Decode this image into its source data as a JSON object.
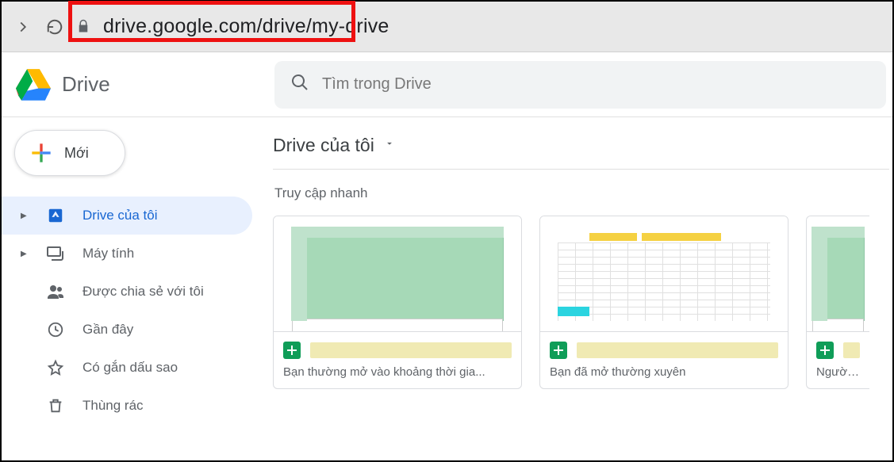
{
  "chrome": {
    "url": "drive.google.com/drive/my-drive"
  },
  "app": {
    "name": "Drive"
  },
  "search": {
    "placeholder": "Tìm trong Drive"
  },
  "sidebar": {
    "new_label": "Mới",
    "items": [
      {
        "label": "Drive của tôi",
        "icon": "my-drive-icon",
        "expandable": true,
        "active": true
      },
      {
        "label": "Máy tính",
        "icon": "computers-icon",
        "expandable": true,
        "active": false
      },
      {
        "label": "Được chia sẻ với tôi",
        "icon": "shared-icon",
        "expandable": false,
        "active": false
      },
      {
        "label": "Gần đây",
        "icon": "recent-icon",
        "expandable": false,
        "active": false
      },
      {
        "label": "Có gắn dấu sao",
        "icon": "starred-icon",
        "expandable": false,
        "active": false
      },
      {
        "label": "Thùng rác",
        "icon": "trash-icon",
        "expandable": false,
        "active": false
      }
    ]
  },
  "breadcrumb": {
    "title": "Drive của tôi"
  },
  "quick_access": {
    "title": "Truy cập nhanh",
    "cards": [
      {
        "subtitle": "Bạn thường mở vào khoảng thời gia...",
        "type": "sheets",
        "thumb": "green"
      },
      {
        "subtitle": "Bạn đã mở thường xuyên",
        "type": "sheets",
        "thumb": "white"
      },
      {
        "subtitle": "Người chỉnh",
        "type": "sheets",
        "thumb": "green"
      }
    ]
  }
}
